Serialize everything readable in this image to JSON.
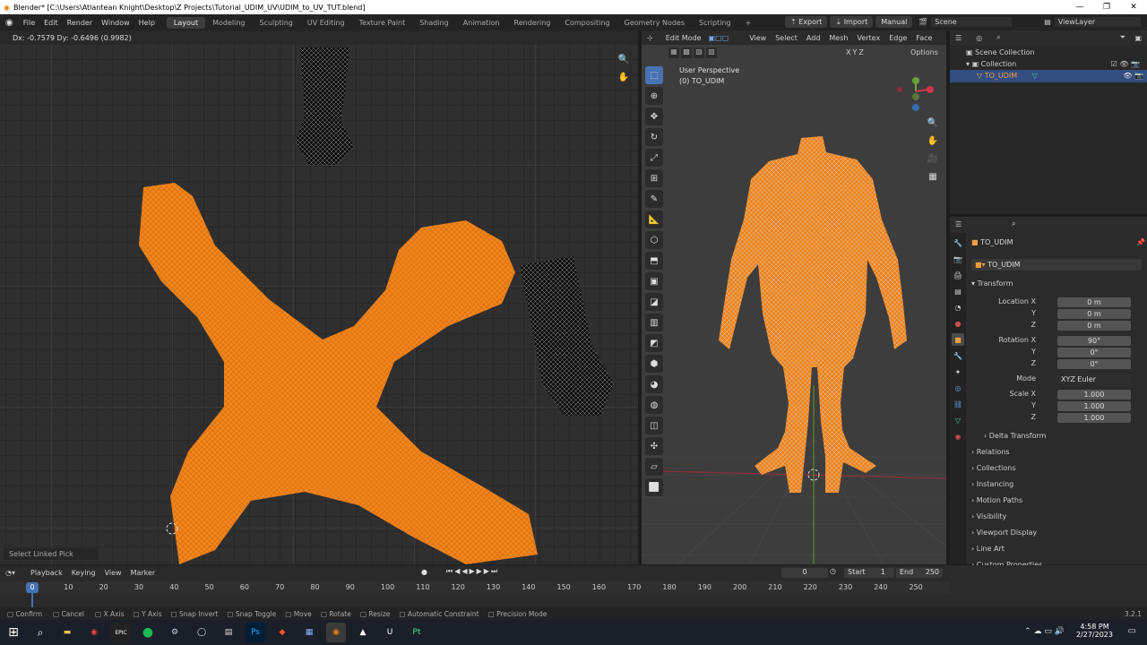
{
  "titlebar": {
    "title": "Blender* [C:\\Users\\Atlantean Knight\\Desktop\\Z Projects\\Tutorial_UDIM_UV\\UDIM_to_UV_TUT.blend]",
    "minimize": "—",
    "maximize": "❐",
    "close": "✕"
  },
  "menus": [
    "File",
    "Edit",
    "Render",
    "Window",
    "Help"
  ],
  "workspaces": [
    "Layout",
    "Modeling",
    "Sculpting",
    "UV Editing",
    "Texture Paint",
    "Shading",
    "Animation",
    "Rendering",
    "Compositing",
    "Geometry Nodes",
    "Scripting",
    "+"
  ],
  "topright": {
    "export": "Export",
    "import": "Import",
    "manual": "Manual",
    "scene": "Scene",
    "viewlayer": "ViewLayer"
  },
  "uv": {
    "readout": "Dx: -0.7579   Dy: -0.6496 (0.9982)",
    "last_op": "Select Linked Pick"
  },
  "viewport": {
    "mode": "Edit Mode",
    "menus": [
      "View",
      "Select",
      "Add",
      "Mesh",
      "Vertex",
      "Edge",
      "Face"
    ],
    "perspective": "User Perspective",
    "object": "(0) TO_UDIM",
    "options": "Options",
    "xyz": [
      "X",
      "Y",
      "Z"
    ]
  },
  "outliner": {
    "scene_collection": "Scene Collection",
    "collection": "Collection",
    "object": "TO_UDIM"
  },
  "properties": {
    "object_name": "TO_UDIM",
    "data_name": "TO_UDIM",
    "transform": "Transform",
    "location_label": "Location X",
    "rotation_label": "Rotation X",
    "scale_label": "Scale X",
    "y": "Y",
    "z": "Z",
    "location": [
      "0 m",
      "0 m",
      "0 m"
    ],
    "rotation": [
      "90°",
      "0°",
      "0°"
    ],
    "mode_label": "Mode",
    "mode_value": "XYZ Euler",
    "scale": [
      "1.000",
      "1.000",
      "1.000"
    ],
    "delta": "Delta Transform",
    "panels": [
      "Relations",
      "Collections",
      "Instancing",
      "Motion Paths",
      "Visibility",
      "Viewport Display",
      "Line Art",
      "Custom Properties"
    ]
  },
  "timeline": {
    "menus": [
      "Playback",
      "Keying",
      "View",
      "Marker"
    ],
    "current": "0",
    "start_label": "Start",
    "start": "1",
    "end_label": "End",
    "end": "250",
    "ticks": [
      "0",
      "10",
      "20",
      "30",
      "40",
      "50",
      "60",
      "70",
      "80",
      "90",
      "100",
      "110",
      "120",
      "130",
      "140",
      "150",
      "160",
      "170",
      "180",
      "190",
      "200",
      "210",
      "220",
      "230",
      "240",
      "250"
    ]
  },
  "status": {
    "items": [
      "Confirm",
      "Cancel",
      "X Axis",
      "Y Axis",
      "Snap Invert",
      "Snap Toggle",
      "Move",
      "Rotate",
      "Resize",
      "Automatic Constraint",
      "Precision Mode"
    ],
    "version": "3.2.1"
  },
  "taskbar": {
    "time": "4:58 PM",
    "date": "2/27/2023",
    "apps": [
      "windows-icon",
      "search-icon",
      "file-explorer-icon",
      "chrome-icon",
      "epic-icon",
      "spotify-icon",
      "steam-icon",
      "github-icon",
      "notes-icon",
      "photoshop-icon",
      "brave-icon",
      "calculator-icon",
      "blender-icon",
      "inkscape-icon",
      "unreal-icon",
      "pt-icon"
    ],
    "app_labels": {
      "epic": "EPIC",
      "photoshop": "Ps",
      "unreal": "U",
      "pt": "Pt"
    }
  },
  "colors": {
    "accent": "#4772b3",
    "orange": "#f0841a",
    "bg": "#2f2f2f"
  }
}
